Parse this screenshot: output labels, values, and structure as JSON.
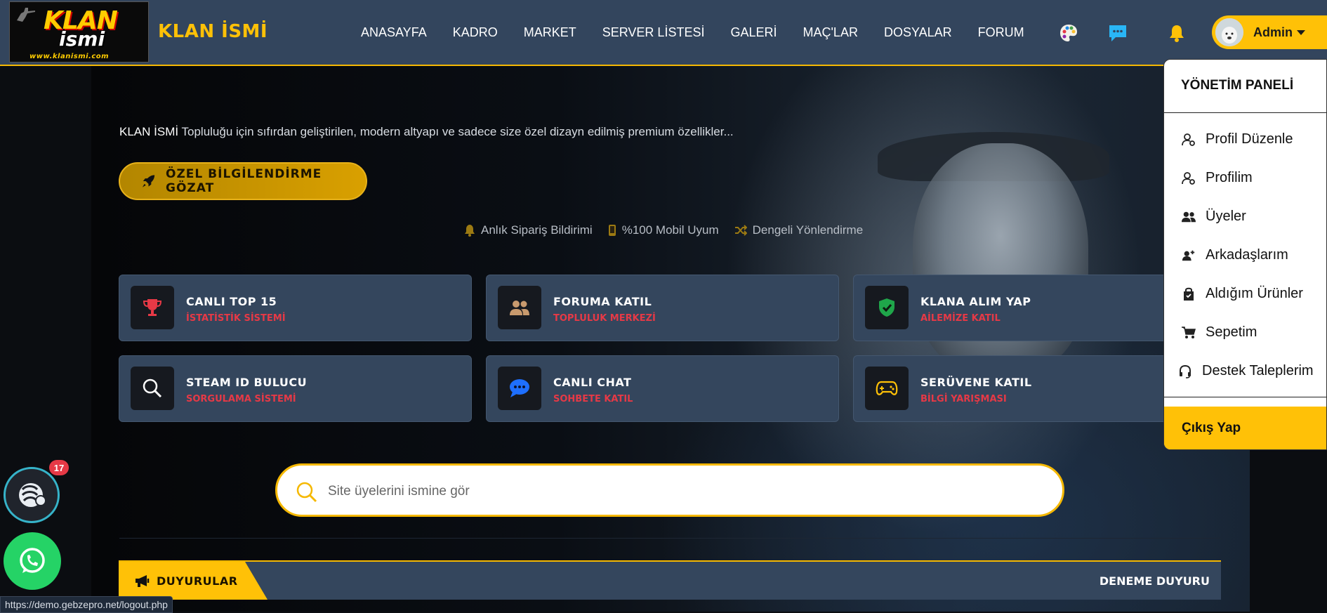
{
  "header": {
    "logo": {
      "line1": "KLAN",
      "line2": "ismi",
      "url": "www.klanismi.com"
    },
    "brand": "KLAN İSMİ",
    "nav": [
      "ANASAYFA",
      "KADRO",
      "MARKET",
      "SERVER LİSTESİ",
      "GALERİ",
      "MAÇ'LAR",
      "DOSYALAR",
      "FORUM"
    ],
    "icons": [
      "palette-icon",
      "chat-icon",
      "bell-icon"
    ],
    "user": {
      "name": "Admin"
    }
  },
  "hero": {
    "tagline_brand": "KLAN İSMİ",
    "tagline_text": " Topluluğu için sıfırdan geliştirilen, modern altyapı ve sadece size özel dizayn edilmiş premium özellikler...",
    "cta_label": "ÖZEL BİLGİLENDİRME GÖZAT",
    "features": [
      "Anlık Sipariş Bildirimi",
      "%100 Mobil Uyum",
      "Dengeli Yönlendirme"
    ]
  },
  "cards": [
    {
      "title": "CANLI TOP 15",
      "subtitle": "İSTATİSTİK SİSTEMİ",
      "icon": "trophy-icon",
      "color": "#e63946"
    },
    {
      "title": "FORUMA KATIL",
      "subtitle": "TOPLULUK MERKEZİ",
      "icon": "users-icon",
      "color": "#c89a6e"
    },
    {
      "title": "KLANA ALIM YAP",
      "subtitle": "AİLEMİZE KATIL",
      "icon": "shield-check-icon",
      "color": "#1fa64a"
    },
    {
      "title": "STEAM ID BULUCU",
      "subtitle": "SORGULAMA SİSTEMİ",
      "icon": "search-icon",
      "color": "#ffffff"
    },
    {
      "title": "CANLI CHAT",
      "subtitle": "SOHBETE KATIL",
      "icon": "comments-icon",
      "color": "#1e6fff"
    },
    {
      "title": "SERÜVENE KATIL",
      "subtitle": "BİLGİ YARIŞMASI",
      "icon": "gamepad-icon",
      "color": "#ffc107"
    }
  ],
  "search": {
    "placeholder": "Site üyelerini ismine gör",
    "value": ""
  },
  "announcements": {
    "label": "DUYURULAR",
    "text": "DENEME DUYURU"
  },
  "floating": {
    "notification_count": "17"
  },
  "statusbar": {
    "url": "https://demo.gebzepro.net/logout.php"
  },
  "dropdown": {
    "title": "YÖNETİM PANELİ",
    "items": [
      {
        "label": "Profil Düzenle",
        "icon": "user-gear-icon"
      },
      {
        "label": "Profilim",
        "icon": "user-gear-icon"
      },
      {
        "label": "Üyeler",
        "icon": "users-icon"
      },
      {
        "label": "Arkadaşlarım",
        "icon": "user-friends-icon"
      },
      {
        "label": "Aldığım Ürünler",
        "icon": "shopping-bag-icon"
      },
      {
        "label": "Sepetim",
        "icon": "cart-icon"
      },
      {
        "label": "Destek Taleplerim",
        "icon": "headset-icon"
      }
    ],
    "logout": "Çıkış Yap"
  },
  "colors": {
    "accent": "#ffc107",
    "navbar": "#33455d",
    "card": "#34465d",
    "danger": "#e63946"
  }
}
